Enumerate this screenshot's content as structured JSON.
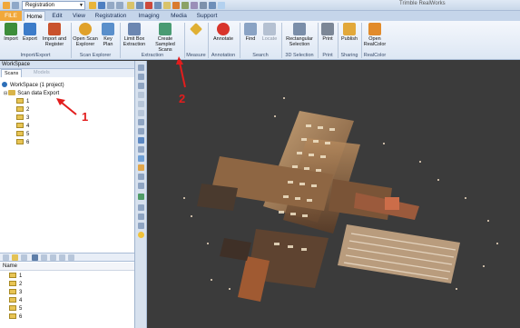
{
  "titlebar": {
    "registration_combo": "Registration",
    "app_title": "Trimble RealWorks"
  },
  "tabs": [
    {
      "label": "FILE",
      "state": "file"
    },
    {
      "label": "Home",
      "state": "active"
    },
    {
      "label": "Edit",
      "state": ""
    },
    {
      "label": "View",
      "state": ""
    },
    {
      "label": "Registration",
      "state": ""
    },
    {
      "label": "Imaging",
      "state": ""
    },
    {
      "label": "Media",
      "state": ""
    },
    {
      "label": "Support",
      "state": ""
    }
  ],
  "ribbon": {
    "buttons": [
      {
        "label": "Import",
        "sub": "",
        "icon": "import-icon",
        "color": "#3d8d3a"
      },
      {
        "label": "Export",
        "sub": "",
        "icon": "export-icon",
        "color": "#3d7cc9"
      },
      {
        "label": "Import and",
        "sub": "Register",
        "icon": "import-register-icon",
        "color": "#c9522d"
      },
      {
        "label": "Open Scan",
        "sub": "Explorer",
        "icon": "scan-explorer-icon",
        "color": "#e0a12a"
      },
      {
        "label": "Key",
        "sub": "Plan",
        "icon": "key-plan-icon",
        "color": "#5a8fcb"
      },
      {
        "label": "Limit Box",
        "sub": "Extraction",
        "icon": "limit-box-icon",
        "color": "#6b86b1"
      },
      {
        "label": "Create",
        "sub": "Sampled Scans",
        "icon": "sampled-scans-icon",
        "color": "#4a9b73"
      },
      {
        "label": "",
        "sub": "",
        "icon": "measure-icon",
        "color": "#e0b033"
      },
      {
        "label": "Annotate",
        "sub": "",
        "icon": "annotate-icon",
        "color": "#d8342b"
      },
      {
        "label": "Find",
        "sub": "",
        "icon": "find-icon",
        "color": "#8aa3c4"
      },
      {
        "label": "Locate",
        "sub": "",
        "icon": "locate-icon",
        "color": "#b5c1d2"
      },
      {
        "label": "Rectangular",
        "sub": "Selection",
        "icon": "rect-selection-icon",
        "color": "#7a8ea9"
      },
      {
        "label": "Print",
        "sub": "",
        "icon": "print-icon",
        "color": "#7c8796"
      },
      {
        "label": "Publish",
        "sub": "",
        "icon": "publish-icon",
        "color": "#e2a83a"
      },
      {
        "label": "Open",
        "sub": "RealColor",
        "icon": "realcolor-icon",
        "color": "#e28b2a"
      }
    ],
    "groups": [
      "Import/Export",
      "Scan Explorer",
      "Extraction",
      "Measure",
      "Annotation",
      "Search",
      "3D Selection",
      "Print",
      "Sharing",
      "RealColor"
    ]
  },
  "workspace": {
    "header": "WorkSpace",
    "tabs": [
      "Scans",
      "Models"
    ],
    "root": "WorkSpace (1 project)",
    "project": "Scan data Export",
    "items": [
      "1",
      "2",
      "3",
      "4",
      "5",
      "6"
    ],
    "name_column": "Name",
    "name_items": [
      "1",
      "2",
      "3",
      "4",
      "5",
      "6"
    ]
  },
  "annotations": [
    "1",
    "2"
  ],
  "colors": {
    "annotation_red": "#e21d1d",
    "tab_file": "#f1a83a",
    "ribbon_bg": "#e6eef8"
  }
}
